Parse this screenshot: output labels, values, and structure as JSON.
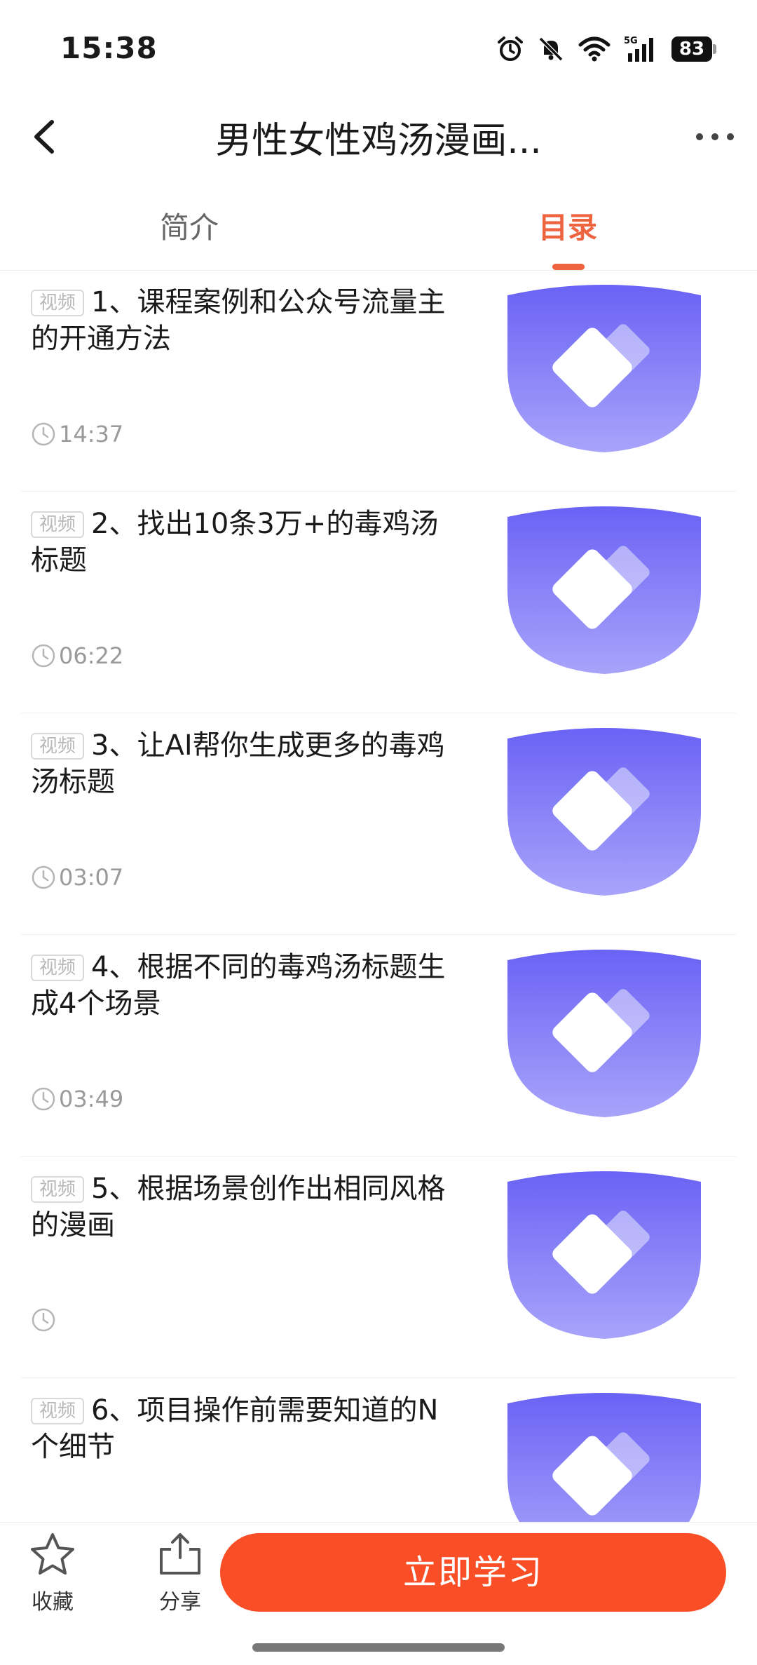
{
  "status_bar": {
    "time": "15:38",
    "network": "5G",
    "battery": "83",
    "icons": [
      "alarm-icon",
      "mute-icon",
      "wifi-icon",
      "cellular-5g-icon",
      "battery-icon"
    ]
  },
  "header": {
    "title": "男性女性鸡汤漫画...",
    "back_icon": "chevron-left-icon",
    "more_icon": "more-dots-icon"
  },
  "tabs": [
    {
      "label": "简介",
      "active": false
    },
    {
      "label": "目录",
      "active": true
    }
  ],
  "lessons": [
    {
      "tag": "视频",
      "title": "1、课程案例和公众号流量主的开通方法",
      "duration": "14:37"
    },
    {
      "tag": "视频",
      "title": "2、找出10条3万+的毒鸡汤标题",
      "duration": "06:22"
    },
    {
      "tag": "视频",
      "title": "3、让AI帮你生成更多的毒鸡汤标题",
      "duration": "03:07"
    },
    {
      "tag": "视频",
      "title": "4、根据不同的毒鸡汤标题生成4个场景",
      "duration": "03:49"
    },
    {
      "tag": "视频",
      "title": "5、根据场景创作出相同风格的漫画",
      "duration": ""
    },
    {
      "tag": "视频",
      "title": "6、项目操作前需要知道的N个细节",
      "duration": ""
    }
  ],
  "bottom_bar": {
    "favorite_label": "收藏",
    "share_label": "分享",
    "study_button": "立即学习"
  },
  "colors": {
    "accent": "#ee6440",
    "button": "#fa4f26",
    "thumb_top": "#6a62f5",
    "thumb_bottom": "#a8a4fa"
  }
}
